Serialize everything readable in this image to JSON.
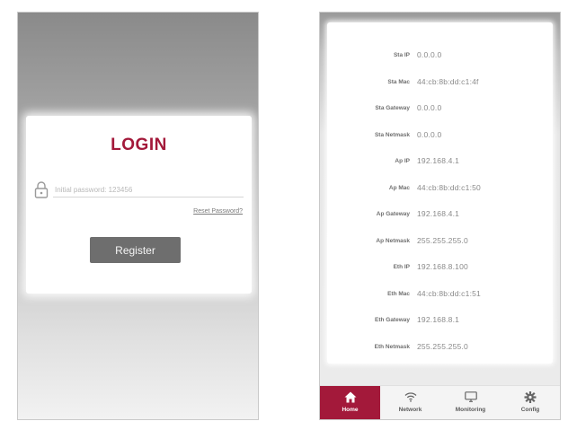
{
  "login": {
    "title": "LOGIN",
    "password_placeholder": "Initial password: 123456",
    "reset_password": "Reset Password?",
    "register_button": "Register"
  },
  "status": {
    "rows": [
      {
        "label": "Sta IP",
        "value": "0.0.0.0"
      },
      {
        "label": "Sta Mac",
        "value": "44:cb:8b:dd:c1:4f"
      },
      {
        "label": "Sta Gateway",
        "value": "0.0.0.0"
      },
      {
        "label": "Sta Netmask",
        "value": "0.0.0.0"
      },
      {
        "label": "Ap IP",
        "value": "192.168.4.1"
      },
      {
        "label": "Ap Mac",
        "value": "44:cb:8b:dd:c1:50"
      },
      {
        "label": "Ap Gateway",
        "value": "192.168.4.1"
      },
      {
        "label": "Ap Netmask",
        "value": "255.255.255.0"
      },
      {
        "label": "Eth IP",
        "value": "192.168.8.100"
      },
      {
        "label": "Eth Mac",
        "value": "44:cb:8b:dd:c1:51"
      },
      {
        "label": "Eth Gateway",
        "value": "192.168.8.1"
      },
      {
        "label": "Eth Netmask",
        "value": "255.255.255.0"
      }
    ]
  },
  "nav": {
    "items": [
      {
        "label": "Home",
        "icon": "home-icon",
        "active": true
      },
      {
        "label": "Network",
        "icon": "wifi-icon",
        "active": false
      },
      {
        "label": "Monitoring",
        "icon": "monitor-icon",
        "active": false
      },
      {
        "label": "Config",
        "icon": "gear-icon",
        "active": false
      }
    ]
  },
  "colors": {
    "accent": "#a3193a",
    "button": "#6e6e6e"
  }
}
